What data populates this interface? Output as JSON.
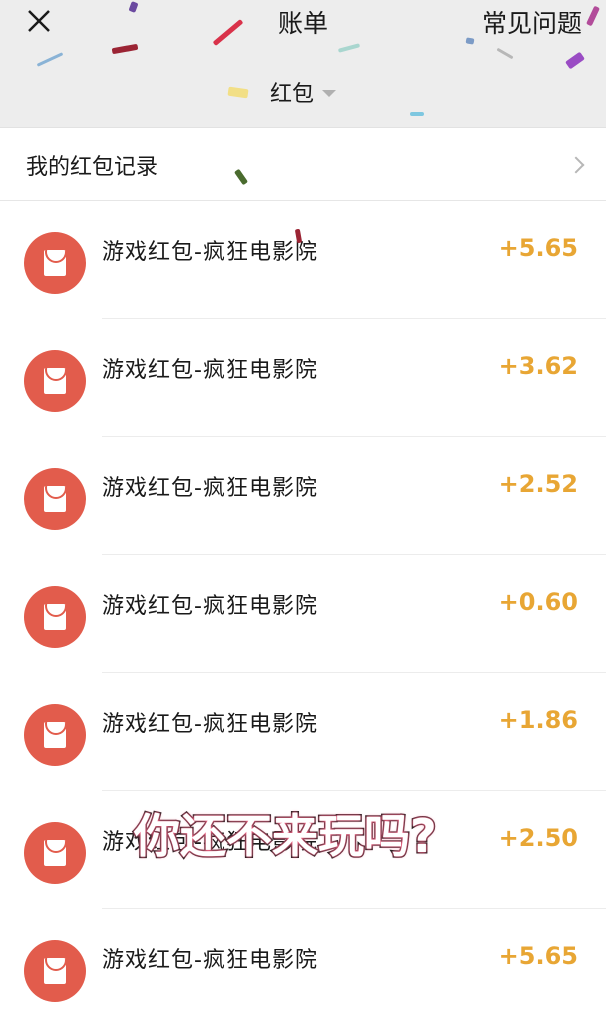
{
  "header": {
    "title": "账单",
    "faq_label": "常见问题",
    "filter_label": "红包"
  },
  "records": {
    "label": "我的红包记录"
  },
  "items": [
    {
      "title": "游戏红包-疯狂电影院",
      "amount": "+5.65"
    },
    {
      "title": "游戏红包-疯狂电影院",
      "amount": "+3.62"
    },
    {
      "title": "游戏红包-疯狂电影院",
      "amount": "+2.52"
    },
    {
      "title": "游戏红包-疯狂电影院",
      "amount": "+0.60"
    },
    {
      "title": "游戏红包-疯狂电影院",
      "amount": "+1.86"
    },
    {
      "title": "游戏红包-疯狂电影院",
      "amount": "+2.50"
    },
    {
      "title": "游戏红包-疯狂电影院",
      "amount": "+5.65"
    }
  ],
  "overlay_caption": "你还不来玩吗?",
  "colors": {
    "amount": "#e8a634",
    "icon_bg": "#e25c4c",
    "header_bg": "#ededed"
  }
}
